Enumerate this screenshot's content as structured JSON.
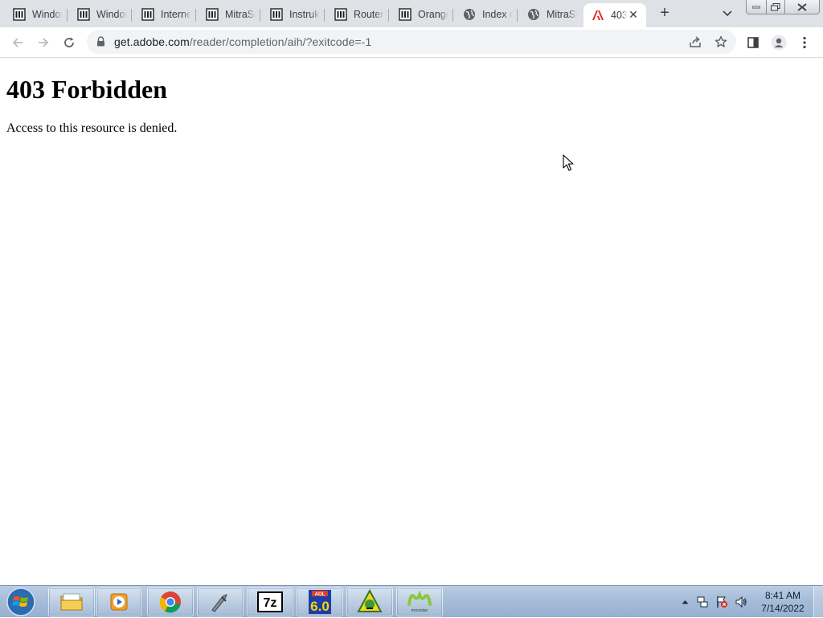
{
  "browser": {
    "tabs": [
      {
        "title": "Windows",
        "icon": "archive-icon"
      },
      {
        "title": "Windows",
        "icon": "archive-icon"
      },
      {
        "title": "Internet",
        "icon": "archive-icon"
      },
      {
        "title": "MitraStar",
        "icon": "archive-icon"
      },
      {
        "title": "Instrukcja",
        "icon": "archive-icon"
      },
      {
        "title": "Router",
        "icon": "archive-icon"
      },
      {
        "title": "Orange",
        "icon": "archive-icon"
      },
      {
        "title": "Index of",
        "icon": "globe-icon"
      },
      {
        "title": "MitraStar",
        "icon": "globe-icon"
      },
      {
        "title": "403",
        "icon": "adobe-icon",
        "active": true
      }
    ],
    "url_host": "get.adobe.com",
    "url_path": "/reader/completion/aih/?exitcode=-1"
  },
  "page": {
    "heading": "403 Forbidden",
    "message": "Access to this resource is denied."
  },
  "taskbar": {
    "items": [
      "explorer",
      "media player",
      "chrome",
      "app",
      "7-zip",
      "aol 6.0",
      "app",
      "movistar"
    ],
    "time": "8:41 AM",
    "date": "7/14/2022"
  },
  "colors": {
    "tabstrip": "#dee1e6",
    "omnibox": "#f1f3f4",
    "adobe_red": "#e3231b",
    "taskbar": "#a6bdd8"
  }
}
